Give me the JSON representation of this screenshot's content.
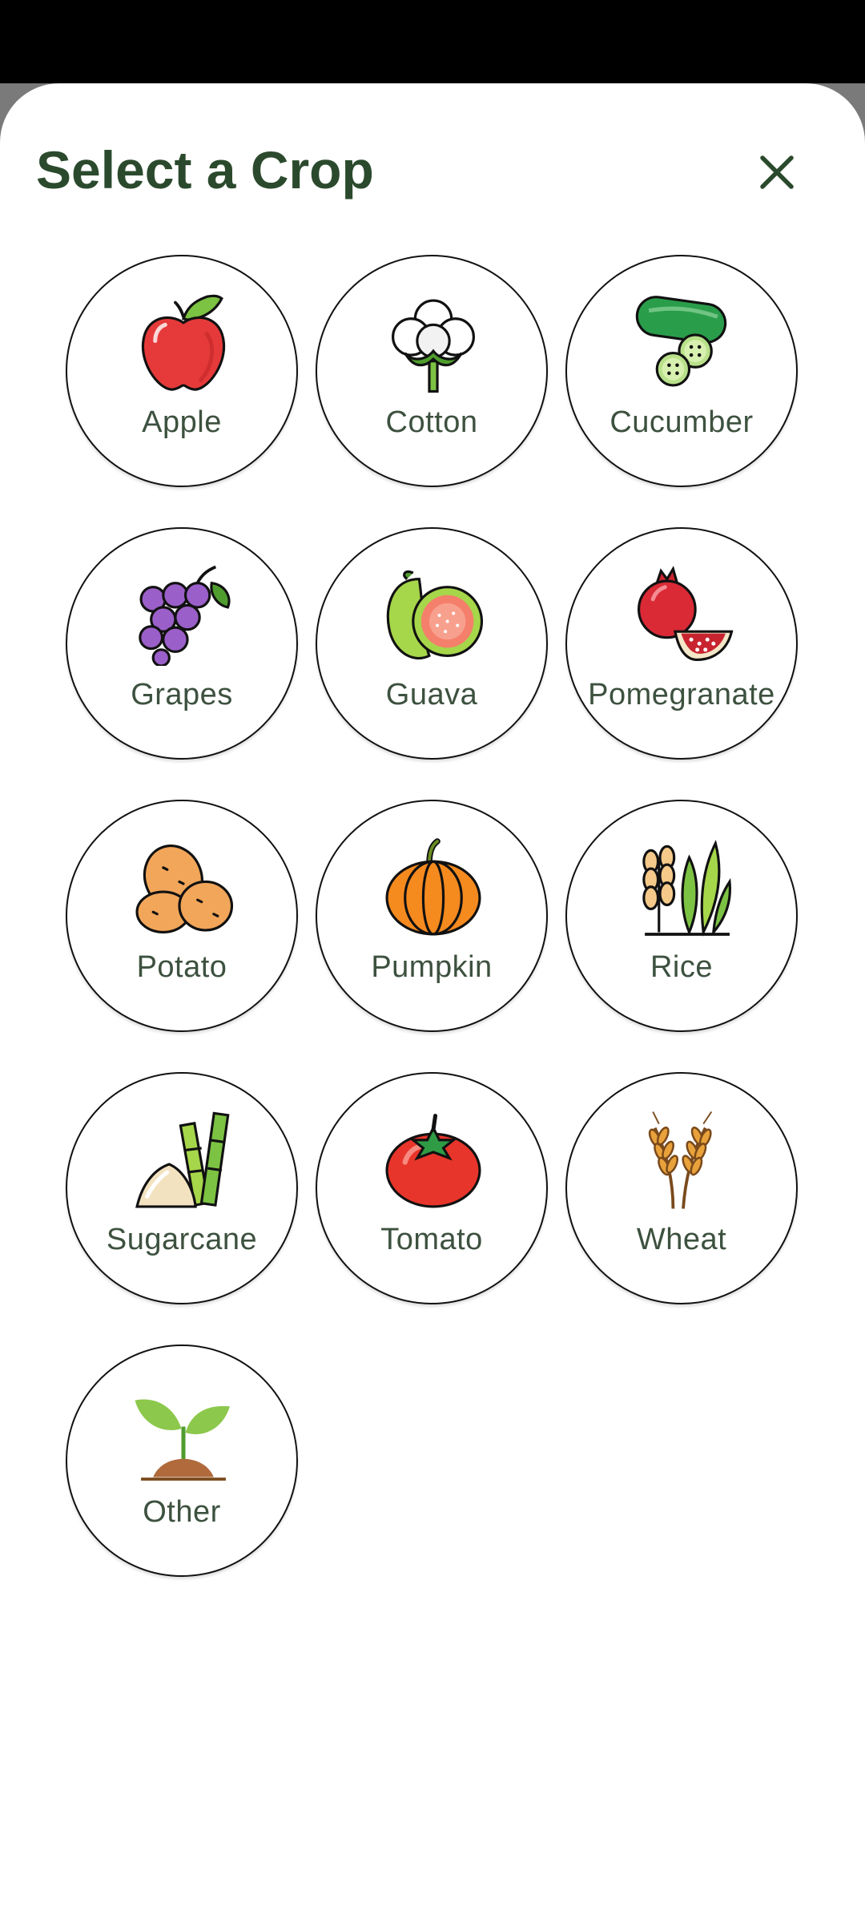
{
  "sheet": {
    "title": "Select a Crop",
    "close_icon": "close-icon"
  },
  "colors": {
    "title_text": "#2b4a2d",
    "label_text": "#3d513f",
    "circle_border": "#111111",
    "sheet_background": "#ffffff",
    "scrim": "#7a7a7a"
  },
  "crops": [
    {
      "label": "Apple",
      "icon": "apple-icon"
    },
    {
      "label": "Cotton",
      "icon": "cotton-icon"
    },
    {
      "label": "Cucumber",
      "icon": "cucumber-icon"
    },
    {
      "label": "Grapes",
      "icon": "grapes-icon"
    },
    {
      "label": "Guava",
      "icon": "guava-icon"
    },
    {
      "label": "Pomegranate",
      "icon": "pomegranate-icon"
    },
    {
      "label": "Potato",
      "icon": "potato-icon"
    },
    {
      "label": "Pumpkin",
      "icon": "pumpkin-icon"
    },
    {
      "label": "Rice",
      "icon": "rice-icon"
    },
    {
      "label": "Sugarcane",
      "icon": "sugarcane-icon"
    },
    {
      "label": "Tomato",
      "icon": "tomato-icon"
    },
    {
      "label": "Wheat",
      "icon": "wheat-icon"
    },
    {
      "label": "Other",
      "icon": "seedling-icon"
    }
  ]
}
